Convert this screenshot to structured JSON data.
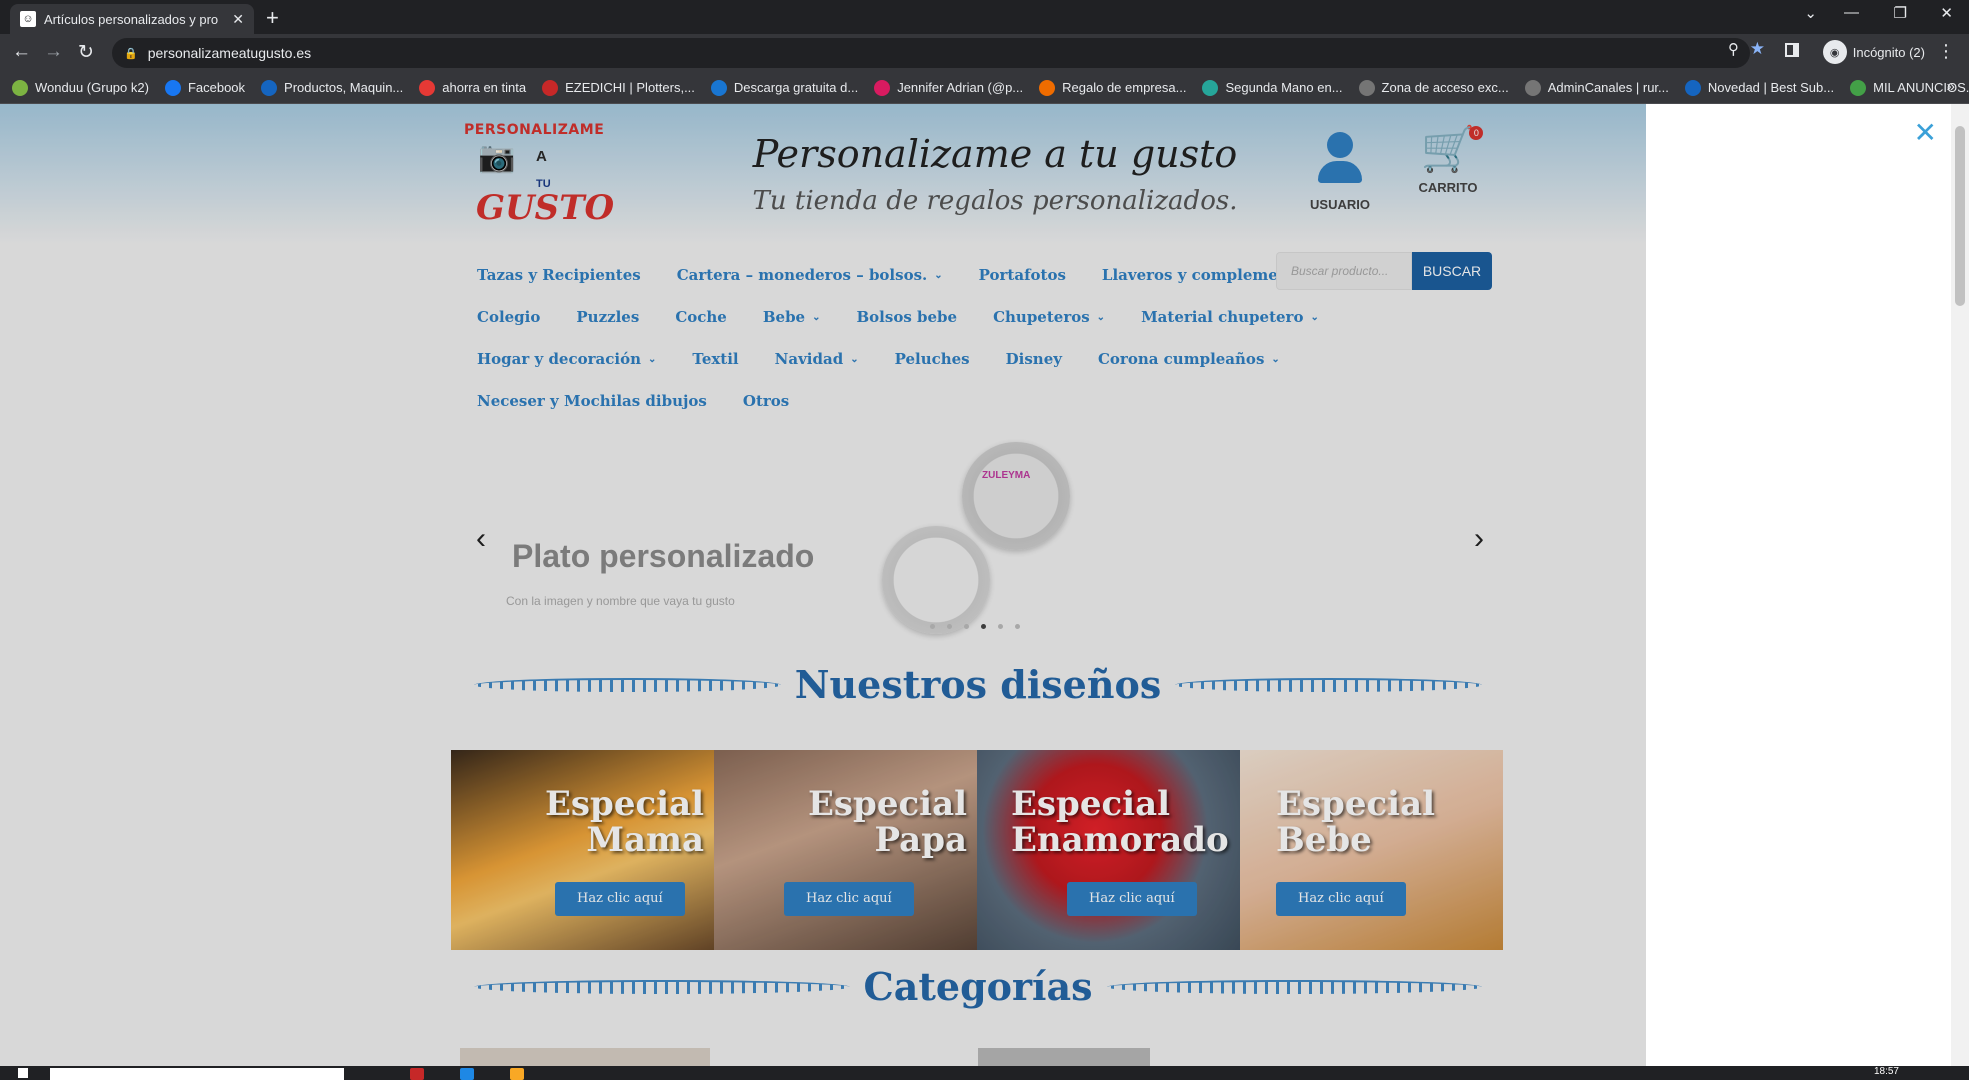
{
  "browser": {
    "tab_title": "Artículos personalizados y pro",
    "url": "personalizameatugusto.es",
    "profile": "Incógnito (2)",
    "bookmarks": [
      {
        "label": "Wonduu (Grupo k2)",
        "color": "#7cb342",
        "icon": "w-icon"
      },
      {
        "label": "Facebook",
        "color": "#1877f2",
        "icon": "facebook-icon"
      },
      {
        "label": "Productos, Maquin...",
        "color": "#1565c0",
        "icon": "b-icon"
      },
      {
        "label": "ahorra en tinta",
        "color": "#e53935",
        "icon": "ink-icon"
      },
      {
        "label": "EZEDICHI | Plotters,...",
        "color": "#c62828",
        "icon": "ezedichi-icon"
      },
      {
        "label": "Descarga gratuita d...",
        "color": "#1976d2",
        "icon": "download-icon"
      },
      {
        "label": "Jennifer Adrian (@p...",
        "color": "#d81b60",
        "icon": "instagram-icon"
      },
      {
        "label": "Regalo de empresa...",
        "color": "#ef6c00",
        "icon": "gift-icon"
      },
      {
        "label": "Segunda Mano en...",
        "color": "#26a69a",
        "icon": "wallapop-icon"
      },
      {
        "label": "Zona de acceso exc...",
        "color": "#757575",
        "icon": "globe-icon"
      },
      {
        "label": "AdminCanales | rur...",
        "color": "#757575",
        "icon": "globe-icon"
      },
      {
        "label": "Novedad | Best Sub...",
        "color": "#1565c0",
        "icon": "b-icon"
      },
      {
        "label": "MIL ANUNCIOS.CO...",
        "color": "#43a047",
        "icon": "milanuncios-icon"
      }
    ]
  },
  "site": {
    "logo": {
      "line1": "PERSONALIZAME",
      "line3": "A",
      "line4": "TU",
      "line5": "GUSTO"
    },
    "title": "Personalizame a tu gusto",
    "subtitle": "Tu tienda de regalos personalizados.",
    "user_label": "USUARIO",
    "cart_label": "CARRITO",
    "cart_count": "0",
    "search_placeholder": "Buscar producto...",
    "search_button": "BUSCAR",
    "menu_rows": [
      [
        {
          "label": "Tazas y Recipientes",
          "dropdown": false
        },
        {
          "label": "Cartera – monederos – bolsos.",
          "dropdown": true
        },
        {
          "label": "Portafotos",
          "dropdown": false
        },
        {
          "label": "Llaveros y complementos",
          "dropdown": false
        }
      ],
      [
        {
          "label": "Colegio",
          "dropdown": false
        },
        {
          "label": "Puzzles",
          "dropdown": false
        },
        {
          "label": "Coche",
          "dropdown": false
        },
        {
          "label": "Bebe",
          "dropdown": true
        },
        {
          "label": "Bolsos bebe",
          "dropdown": false
        },
        {
          "label": "Chupeteros",
          "dropdown": true
        },
        {
          "label": "Material chupetero",
          "dropdown": true
        }
      ],
      [
        {
          "label": "Hogar y decoración",
          "dropdown": true
        },
        {
          "label": "Textil",
          "dropdown": false
        },
        {
          "label": "Navidad",
          "dropdown": true
        },
        {
          "label": "Peluches",
          "dropdown": false
        },
        {
          "label": "Disney",
          "dropdown": false
        },
        {
          "label": "Corona cumpleaños",
          "dropdown": true
        }
      ],
      [
        {
          "label": "Neceser y Mochilas dibujos",
          "dropdown": false
        },
        {
          "label": "Otros",
          "dropdown": false
        }
      ]
    ],
    "slider": {
      "title": "Plato personalizado",
      "subtitle": "Con la imagen y nombre que vaya tu gusto",
      "plate_text": "ZULEYMA",
      "active_slide": 3,
      "total_slides": 6
    },
    "section_designs": "Nuestros diseños",
    "section_categories": "Categorías",
    "designs": [
      {
        "line1": "Especial",
        "line2": "Mama",
        "button": "Haz clic aquí",
        "bg": "linear-gradient(160deg,#3a2a1c 0%,#f0a53a 45%,#f7c66a 60%,#6b4a2a 100%)"
      },
      {
        "line1": "Especial",
        "line2": "Papa",
        "button": "Haz clic aquí",
        "bg": "linear-gradient(160deg,#8a6a58 0%,#c9a48c 40%,#5a4538 100%)"
      },
      {
        "line1": "Especial",
        "line2": "Enamorado",
        "button": "Haz clic aquí",
        "bg": "radial-gradient(circle at 45% 40%,#e8232b 0%,#c21a20 35%,#5c6d7e 60%,#40505f 100%)"
      },
      {
        "line1": "Especial",
        "line2": "Bebe",
        "button": "Haz clic aquí",
        "bg": "linear-gradient(160deg,#f3e4d6 0%,#eac0a2 50%,#c98a3a 100%)"
      }
    ]
  },
  "taskbar": {
    "time": "18:57"
  }
}
